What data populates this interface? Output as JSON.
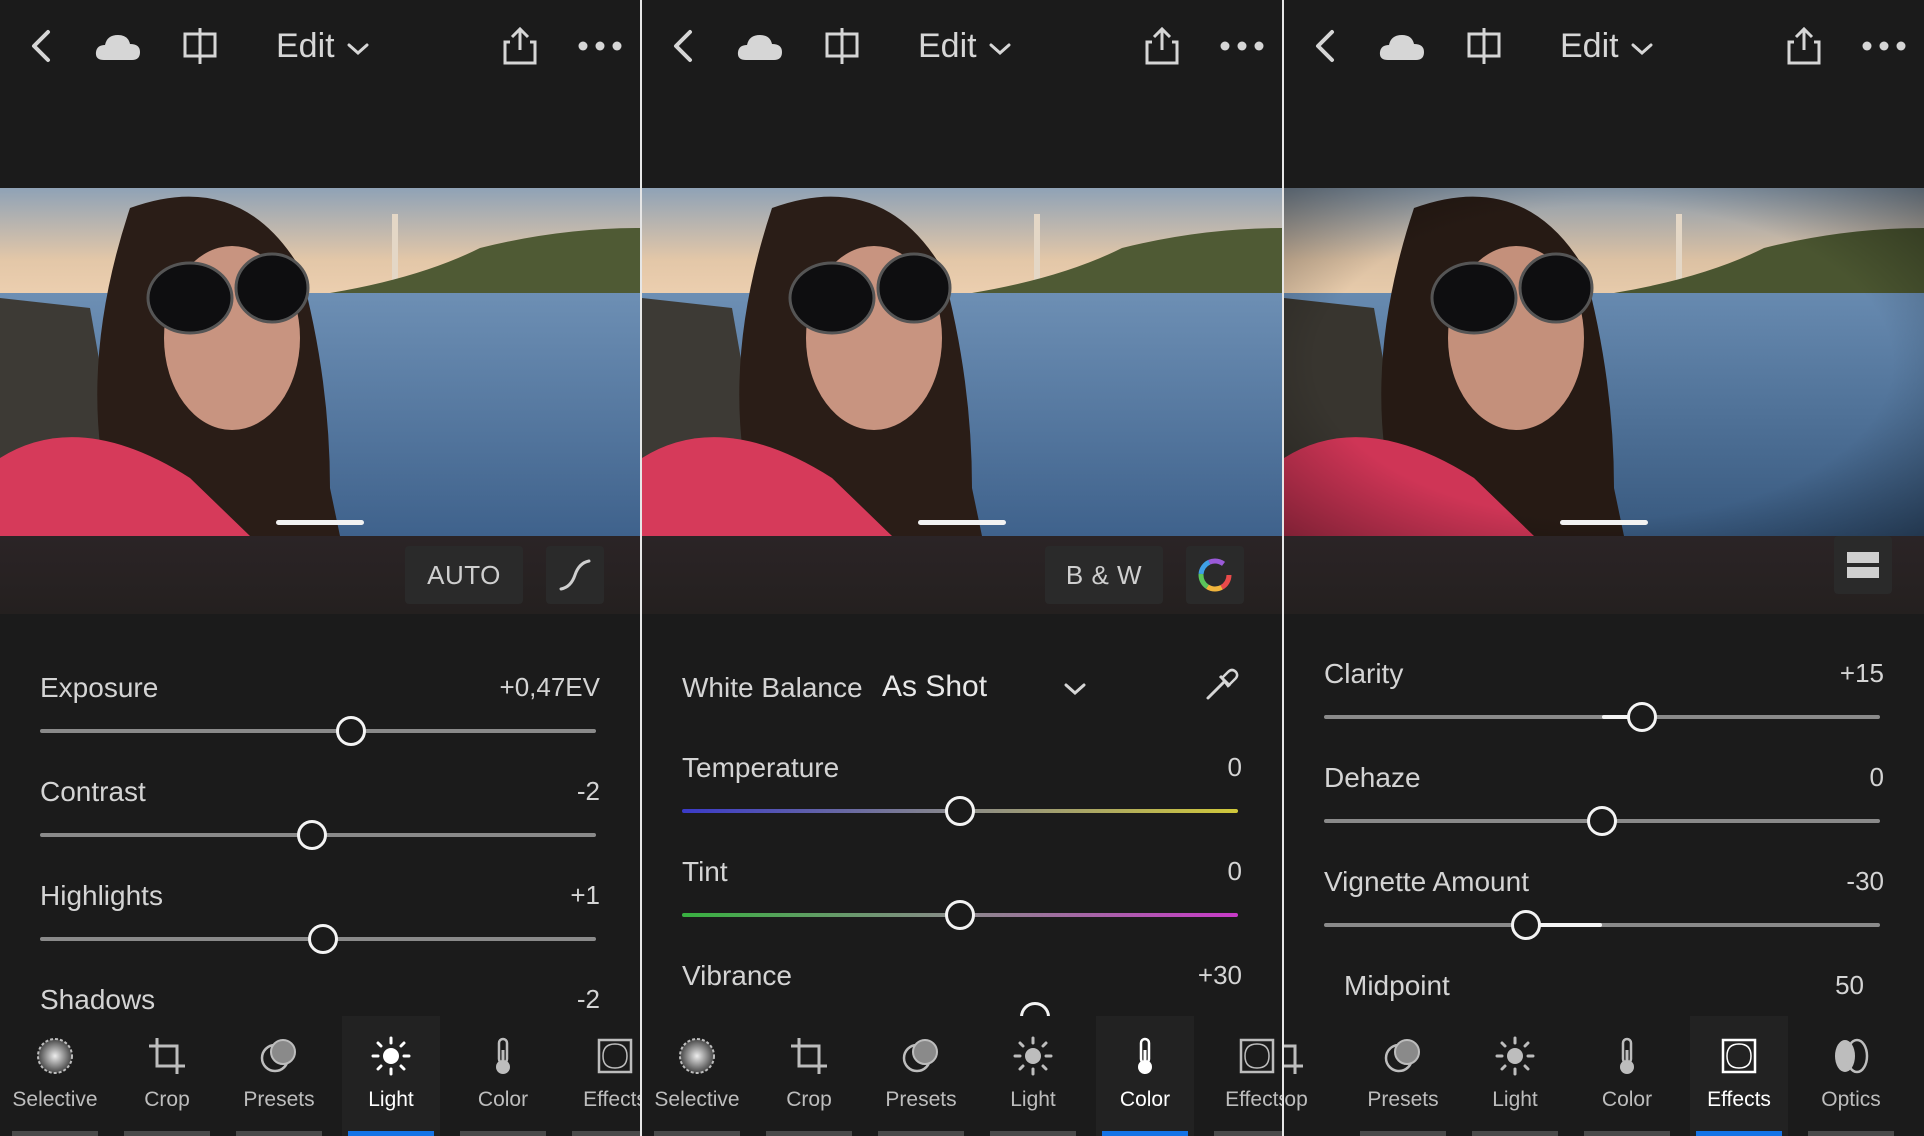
{
  "panels": [
    {
      "topbar": {
        "edit_label": "Edit"
      },
      "tool_buttons": {
        "auto_label": "AUTO"
      },
      "sliders": [
        {
          "label": "Exposure",
          "value": "+0,47EV",
          "level": 0.56
        },
        {
          "label": "Contrast",
          "value": "-2",
          "level": 0.49
        },
        {
          "label": "Highlights",
          "value": "+1",
          "level": 0.505
        },
        {
          "label": "Shadows",
          "value": "-2"
        }
      ],
      "tabs": [
        "Selective",
        "Crop",
        "Presets",
        "Light",
        "Color",
        "Effects"
      ],
      "active_tab": "Light"
    },
    {
      "topbar": {
        "edit_label": "Edit"
      },
      "tool_buttons": {
        "bw_label": "B & W"
      },
      "white_balance": {
        "label": "White Balance",
        "value": "As Shot"
      },
      "sliders": [
        {
          "label": "Temperature",
          "value": "0",
          "level": 0.5
        },
        {
          "label": "Tint",
          "value": "0",
          "level": 0.5
        },
        {
          "label": "Vibrance",
          "value": "+30",
          "level": 0.65
        }
      ],
      "tabs": [
        "Selective",
        "Crop",
        "Presets",
        "Light",
        "Color",
        "Effects"
      ],
      "active_tab": "Color"
    },
    {
      "topbar": {
        "edit_label": "Edit"
      },
      "sliders": [
        {
          "label": "Clarity",
          "value": "+15",
          "level": 0.575
        },
        {
          "label": "Dehaze",
          "value": "0",
          "level": 0.5
        },
        {
          "label": "Vignette Amount",
          "value": "-30",
          "level": 0.35
        },
        {
          "label": "Midpoint",
          "value": "50"
        }
      ],
      "tabs": [
        "Crop",
        "Presets",
        "Light",
        "Color",
        "Effects",
        "Optics"
      ],
      "active_tab": "Effects"
    }
  ],
  "colors": {
    "accent": "#1473e6",
    "background": "#1b1b1b"
  },
  "icons": [
    "back-chevron-icon",
    "cloud-icon",
    "compare-icon",
    "chevron-down-icon",
    "share-icon",
    "more-icon",
    "curve-icon",
    "color-mix-icon",
    "eyedropper-icon",
    "profile-icon"
  ]
}
